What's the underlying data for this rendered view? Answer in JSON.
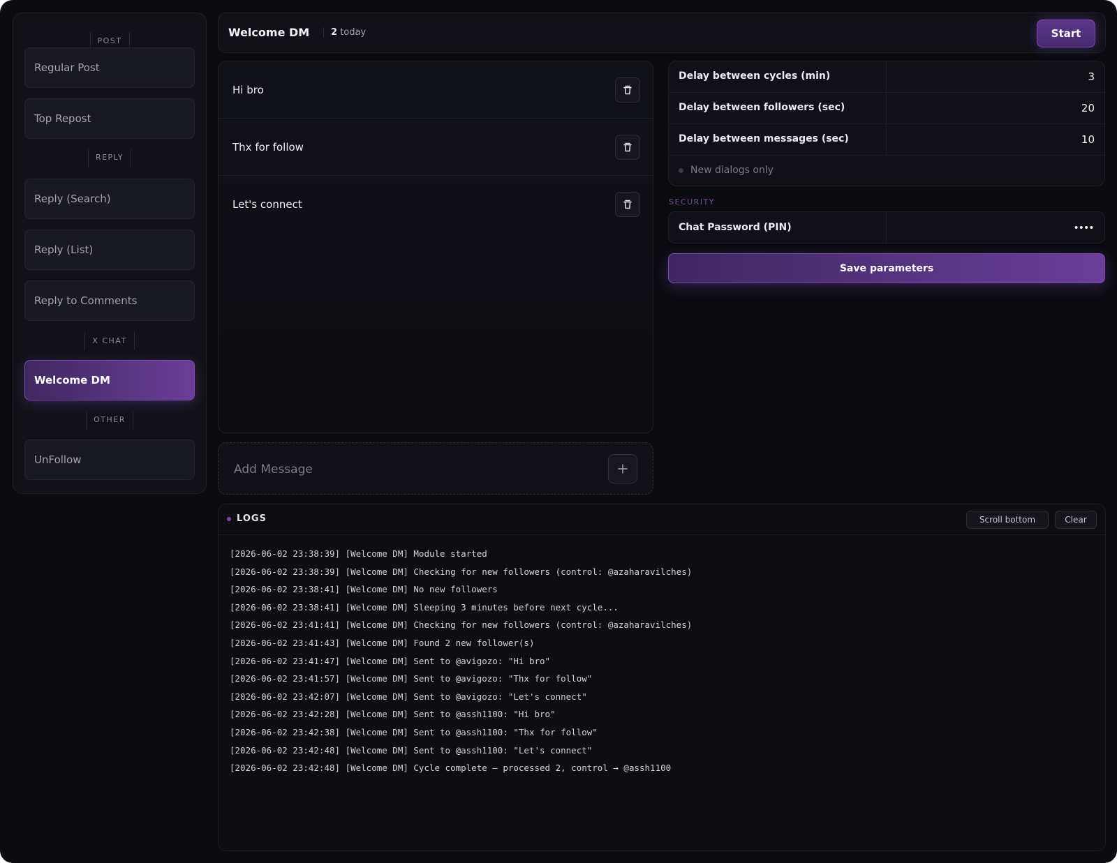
{
  "sidebar": {
    "sections": {
      "post": "POST",
      "reply": "REPLY",
      "xchat": "X CHAT",
      "other": "OTHER"
    },
    "items": [
      {
        "label": "Regular Post"
      },
      {
        "label": "Top Repost"
      },
      {
        "label": "Reply (Search)"
      },
      {
        "label": "Reply (List)"
      },
      {
        "label": "Reply to Comments"
      },
      {
        "label": "Welcome DM",
        "active": true
      },
      {
        "label": "UnFollow"
      }
    ]
  },
  "header": {
    "title": "Welcome DM",
    "count": "2",
    "count_suffix": "today",
    "start_label": "Start"
  },
  "messages": [
    {
      "text": "Hi bro"
    },
    {
      "text": "Thx for follow"
    },
    {
      "text": "Let's connect"
    }
  ],
  "add_message": {
    "placeholder": "Add Message",
    "value": ""
  },
  "params": {
    "rows": [
      {
        "label": "Delay between cycles (min)",
        "value": "3"
      },
      {
        "label": "Delay between followers (sec)",
        "value": "20"
      },
      {
        "label": "Delay between messages (sec)",
        "value": "10"
      }
    ],
    "toggle_label": "New dialogs only",
    "toggle_on": false
  },
  "security": {
    "title": "SECURITY",
    "pin_label": "Chat Password (PIN)",
    "pin_value": "••••"
  },
  "save_label": "Save parameters",
  "logs": {
    "title": "LOGS",
    "scroll_label": "Scroll bottom",
    "clear_label": "Clear",
    "lines": [
      "[2026-06-02 23:38:39] [Welcome DM] Module started",
      "[2026-06-02 23:38:39] [Welcome DM] Checking for new followers (control: @azaharavilches)",
      "[2026-06-02 23:38:41] [Welcome DM] No new followers",
      "[2026-06-02 23:38:41] [Welcome DM] Sleeping 3 minutes before next cycle...",
      "[2026-06-02 23:41:41] [Welcome DM] Checking for new followers (control: @azaharavilches)",
      "[2026-06-02 23:41:43] [Welcome DM] Found 2 new follower(s)",
      "[2026-06-02 23:41:47] [Welcome DM] Sent to @avigozo: \"Hi bro\"",
      "[2026-06-02 23:41:57] [Welcome DM] Sent to @avigozo: \"Thx for follow\"",
      "[2026-06-02 23:42:07] [Welcome DM] Sent to @avigozo: \"Let's connect\"",
      "[2026-06-02 23:42:28] [Welcome DM] Sent to @assh1100: \"Hi bro\"",
      "[2026-06-02 23:42:38] [Welcome DM] Sent to @assh1100: \"Thx for follow\"",
      "[2026-06-02 23:42:48] [Welcome DM] Sent to @assh1100: \"Let's connect\"",
      "[2026-06-02 23:42:48] [Welcome DM] Cycle complete — processed 2, control → @assh1100"
    ]
  },
  "colors": {
    "background": "#0b0b10",
    "panel": "#111117",
    "accent": "#6a3e98",
    "accent_border": "#7a4cb0"
  },
  "icons": {
    "delete": "trash-icon",
    "add": "plus-icon",
    "status": "dot-icon"
  }
}
